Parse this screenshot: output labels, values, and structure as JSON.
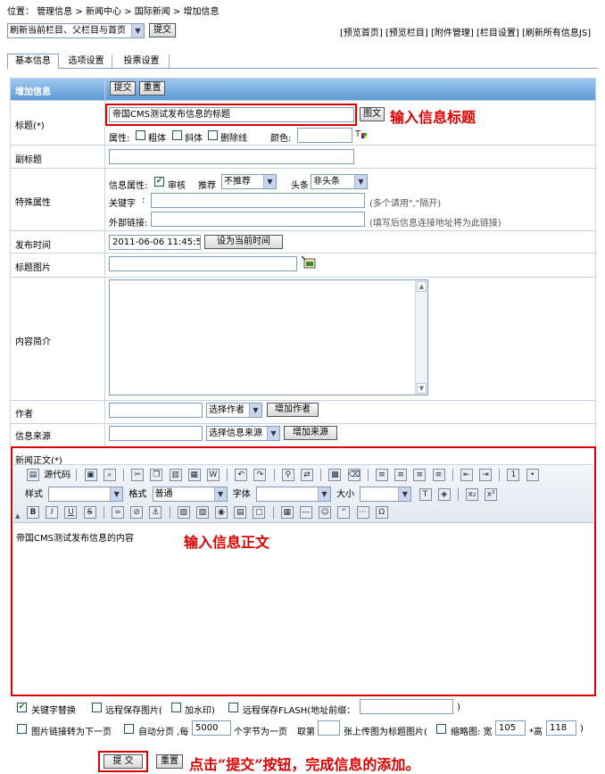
{
  "breadcrumb": {
    "prefix": "位置：",
    "items": [
      "管理信息",
      "新闻中心",
      "国际新闻",
      "增加信息"
    ],
    "sep": ">"
  },
  "refresh": {
    "select_value": "刷新当前栏目、父栏目与首页",
    "submit": "提交"
  },
  "top_links": [
    "[预览首页]",
    "[预览栏目]",
    "[附件管理]",
    "[栏目设置]",
    "[刷新所有信息JS]"
  ],
  "tabs": [
    "基本信息",
    "选项设置",
    "投票设置"
  ],
  "header": {
    "title": "增加信息",
    "submit": "提交",
    "reset": "重置"
  },
  "fields": {
    "title": {
      "label": "标题(*)",
      "value": "帝国CMS测试发布信息的标题",
      "pic_button": "图文"
    },
    "attrs": {
      "label": "属性:",
      "bold": "粗体",
      "italic": "斜体",
      "strike": "删除线",
      "color_label": "颜色:"
    },
    "subtitle": {
      "label": "副标题"
    },
    "special": {
      "label": "特殊属性",
      "info_attr": "信息属性:",
      "audit": "审核",
      "recommend": "推荐",
      "recommend_value": "不推荐",
      "headline": "头条",
      "headline_value": "非头条",
      "keyword": "关键字",
      "keyword_hint": "(多个请用\",\"隔开)",
      "link": "外部链接:",
      "link_hint": "(填写后信息连接地址将为此链接)"
    },
    "pubtime": {
      "label": "发布时间",
      "value": "2011-06-06 11:45:57",
      "button": "设为当前时间"
    },
    "titlepic": {
      "label": "标题图片"
    },
    "summary": {
      "label": "内容简介"
    },
    "author": {
      "label": "作者",
      "select": "选择作者",
      "button": "增加作者"
    },
    "source": {
      "label": "信息来源",
      "select": "选择信息来源",
      "button": "增加来源"
    }
  },
  "editor": {
    "label": "新闻正文(*)",
    "source": "源代码",
    "style_label": "样式",
    "format_label": "格式",
    "format_value": "普通",
    "font_label": "字体",
    "size_label": "大小",
    "content": "帝国CMS测试发布信息的内容"
  },
  "options": {
    "keyword_replace": "关键字替换",
    "remote_save": "远程保存图片(",
    "watermark": "加水印)",
    "remote_flash": "远程保存FLASH(地址前缀：",
    "close_paren": ")",
    "pic_next": "图片链接转为下一页",
    "auto_page": "自动分页 ,每",
    "page_chars": "5000",
    "page_chars_suffix": "个字节为一页",
    "take_label": "取第",
    "take_suffix": "张上传图为标题图片(",
    "thumb": "缩略图: 宽",
    "thumb_w": "105",
    "thumb_h_label": "*高",
    "thumb_h": "118"
  },
  "footer": {
    "submit": "提 交",
    "reset": "重置"
  },
  "annotations": {
    "title": "输入信息标题",
    "content": "输入信息正文",
    "submit": "点击“提交”按钮，完成信息的添加。"
  }
}
